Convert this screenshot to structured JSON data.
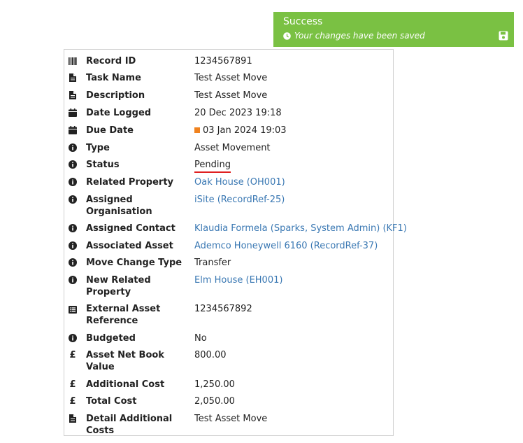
{
  "toast": {
    "title": "Success",
    "message": "Your changes have been saved",
    "icon_clock": "clock-icon",
    "icon_save": "save-icon",
    "color": "#7ac143"
  },
  "fields": {
    "record_id": {
      "label": "Record ID",
      "value": "1234567891",
      "icon": "barcode-icon"
    },
    "task_name": {
      "label": "Task Name",
      "value": "Test Asset Move",
      "icon": "document-icon"
    },
    "description": {
      "label": "Description",
      "value": "Test Asset Move",
      "icon": "document-icon"
    },
    "date_logged": {
      "label": "Date Logged",
      "value": "20 Dec 2023 19:18",
      "icon": "calendar-icon"
    },
    "due_date": {
      "label": "Due Date",
      "value": "03 Jan 2024 19:03",
      "icon": "calendar-icon",
      "flag_color": "#f0821e"
    },
    "type": {
      "label": "Type",
      "value": "Asset Movement",
      "icon": "info-icon"
    },
    "status": {
      "label": "Status",
      "value": "Pending",
      "icon": "info-icon"
    },
    "related_property": {
      "label": "Related Property",
      "value": "Oak House (OH001)",
      "icon": "info-icon"
    },
    "assigned_organisation": {
      "label_line1": "Assigned",
      "label_line2": "Organisation",
      "value": "iSite (RecordRef-25)",
      "icon": "info-icon"
    },
    "assigned_contact": {
      "label": "Assigned Contact",
      "value": "Klaudia Formela (Sparks, System Admin) (KF1)",
      "icon": "info-icon"
    },
    "associated_asset": {
      "label": "Associated Asset",
      "value": "Ademco Honeywell 6160 (RecordRef-37)",
      "icon": "info-icon"
    },
    "move_change_type": {
      "label": "Move Change Type",
      "value": "Transfer",
      "icon": "info-icon"
    },
    "new_related_property": {
      "label_line1": "New Related",
      "label_line2": "Property",
      "value": "Elm House (EH001)",
      "icon": "info-icon"
    },
    "external_asset_reference": {
      "label_line1": "External Asset",
      "label_line2": "Reference",
      "value": "1234567892",
      "icon": "list-icon"
    },
    "budgeted": {
      "label": "Budgeted",
      "value": "No",
      "icon": "info-icon"
    },
    "asset_net_book_value": {
      "label_line1": "Asset Net Book",
      "label_line2": "Value",
      "value": "800.00",
      "icon": "pound-icon"
    },
    "additional_cost": {
      "label": "Additional Cost",
      "value": "1,250.00",
      "icon": "pound-icon"
    },
    "total_cost": {
      "label": "Total Cost",
      "value": "2,050.00",
      "icon": "pound-icon"
    },
    "detail_additional_costs": {
      "label_line1": "Detail Additional",
      "label_line2": "Costs",
      "value": "Test Asset Move",
      "icon": "document-icon"
    }
  },
  "pound_symbol": "£",
  "link_color": "#3a78b3"
}
